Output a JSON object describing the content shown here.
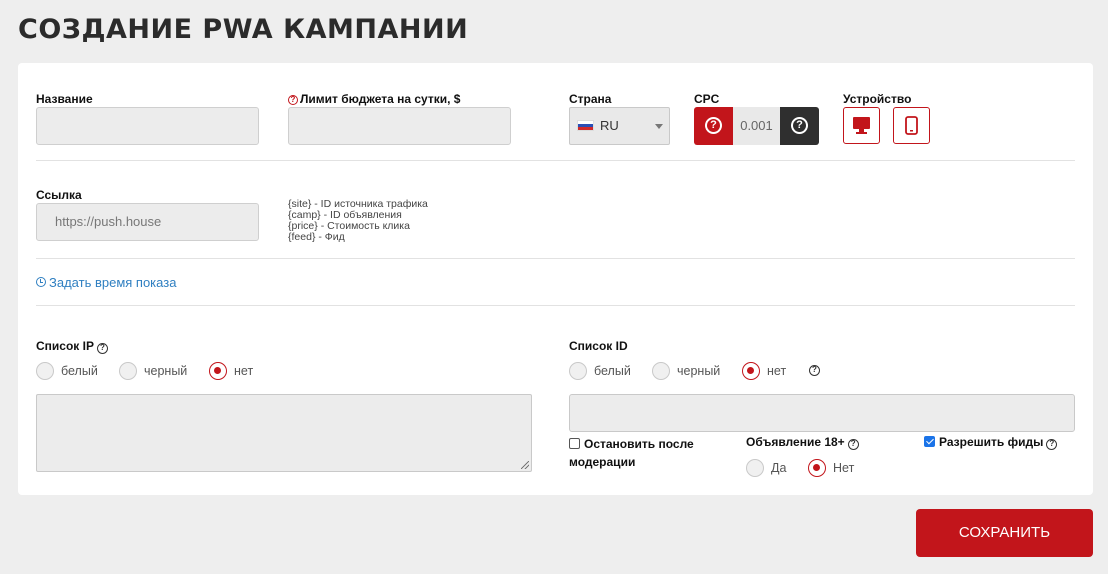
{
  "page": {
    "title": "СОЗДАНИЕ PWA КАМПАНИИ"
  },
  "form": {
    "name": {
      "label": "Название",
      "value": ""
    },
    "budget": {
      "label": "Лимит бюджета на сутки, $",
      "value": ""
    },
    "country": {
      "label": "Страна",
      "value": "RU",
      "flag": "russia-flag-icon"
    },
    "cpc": {
      "label": "CPC",
      "value": "0.001"
    },
    "device": {
      "label": "Устройство",
      "options": [
        "desktop-icon",
        "mobile-icon"
      ]
    },
    "link": {
      "label": "Ссылка",
      "placeholder": "https://push.house"
    },
    "macros": [
      "{site} - ID источника трафика",
      "{camp} - ID объявления",
      "{price} - Стоимость клика",
      "{feed} - Фид"
    ],
    "schedule_link": "Задать время показа",
    "ip_list": {
      "label": "Список IP",
      "options": [
        "белый",
        "черный",
        "нет"
      ],
      "selected": "нет"
    },
    "id_list": {
      "label": "Список ID",
      "options": [
        "белый",
        "черный",
        "нет"
      ],
      "selected": "нет"
    },
    "stop_after_moderation": {
      "label_line1": "Остановить после",
      "label_line2": "модерации",
      "checked": false
    },
    "adult": {
      "label": "Объявление 18+",
      "options": [
        "Да",
        "Нет"
      ],
      "selected": "Нет"
    },
    "allow_feeds": {
      "label": "Разрешить фиды",
      "checked": true
    }
  },
  "actions": {
    "save": "СОХРАНИТЬ"
  },
  "colors": {
    "accent": "#c2151b",
    "dark": "#2f2f2f",
    "link": "#2f7fc1"
  }
}
